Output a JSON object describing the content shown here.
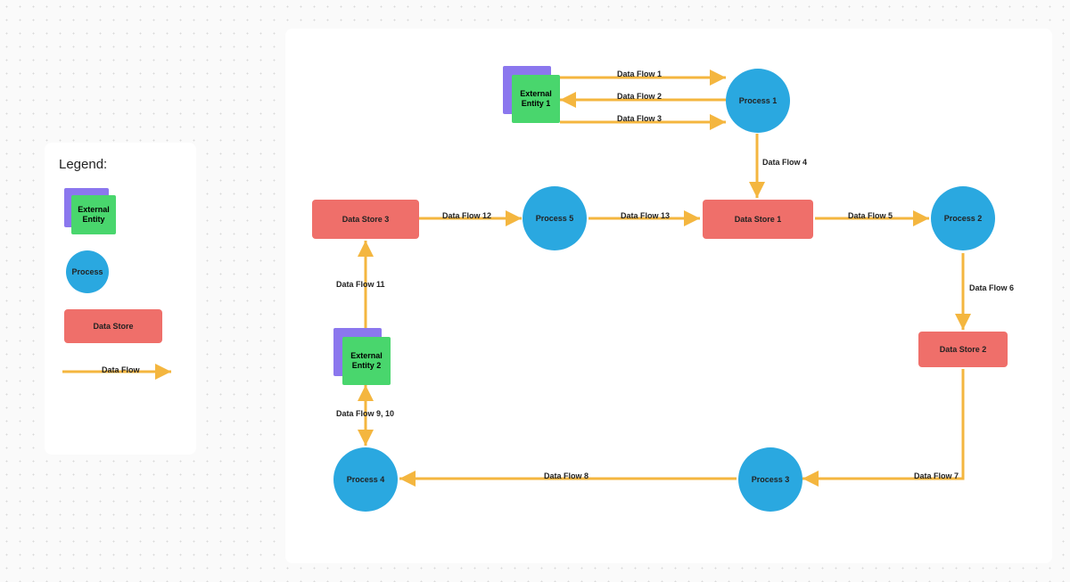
{
  "legend": {
    "title": "Legend:",
    "entity": "External\nEntity",
    "process": "Process",
    "datastore": "Data Store",
    "flow": "Data Flow"
  },
  "nodes": {
    "entity1": "External\nEntity 1",
    "entity2": "External\nEntity 2",
    "process1": "Process 1",
    "process2": "Process 2",
    "process3": "Process 3",
    "process4": "Process 4",
    "process5": "Process 5",
    "datastore1": "Data Store 1",
    "datastore2": "Data Store 2",
    "datastore3": "Data Store 3"
  },
  "flows": {
    "f1": "Data Flow 1",
    "f2": "Data Flow 2",
    "f3": "Data Flow 3",
    "f4": "Data Flow 4",
    "f5": "Data Flow 5",
    "f6": "Data Flow 6",
    "f7": "Data Flow 7",
    "f8": "Data Flow 8",
    "f910": "Data Flow 9, 10",
    "f11": "Data Flow 11",
    "f12": "Data Flow 12",
    "f13": "Data Flow 13"
  },
  "chart_data": {
    "type": "data-flow-diagram",
    "nodes": [
      {
        "id": "E1",
        "type": "external-entity",
        "label": "External Entity 1"
      },
      {
        "id": "E2",
        "type": "external-entity",
        "label": "External Entity 2"
      },
      {
        "id": "P1",
        "type": "process",
        "label": "Process 1"
      },
      {
        "id": "P2",
        "type": "process",
        "label": "Process 2"
      },
      {
        "id": "P3",
        "type": "process",
        "label": "Process 3"
      },
      {
        "id": "P4",
        "type": "process",
        "label": "Process 4"
      },
      {
        "id": "P5",
        "type": "process",
        "label": "Process 5"
      },
      {
        "id": "D1",
        "type": "data-store",
        "label": "Data Store 1"
      },
      {
        "id": "D2",
        "type": "data-store",
        "label": "Data Store 2"
      },
      {
        "id": "D3",
        "type": "data-store",
        "label": "Data Store 3"
      }
    ],
    "edges": [
      {
        "label": "Data Flow 1",
        "from": "E1",
        "to": "P1"
      },
      {
        "label": "Data Flow 2",
        "from": "P1",
        "to": "E1"
      },
      {
        "label": "Data Flow 3",
        "from": "E1",
        "to": "P1"
      },
      {
        "label": "Data Flow 4",
        "from": "P1",
        "to": "D1"
      },
      {
        "label": "Data Flow 5",
        "from": "D1",
        "to": "P2"
      },
      {
        "label": "Data Flow 6",
        "from": "P2",
        "to": "D2"
      },
      {
        "label": "Data Flow 7",
        "from": "D2",
        "to": "P3"
      },
      {
        "label": "Data Flow 8",
        "from": "P3",
        "to": "P4"
      },
      {
        "label": "Data Flow 9",
        "from": "P4",
        "to": "E2"
      },
      {
        "label": "Data Flow 10",
        "from": "E2",
        "to": "P4"
      },
      {
        "label": "Data Flow 11",
        "from": "E2",
        "to": "D3"
      },
      {
        "label": "Data Flow 12",
        "from": "D3",
        "to": "P5"
      },
      {
        "label": "Data Flow 13",
        "from": "P5",
        "to": "D1"
      }
    ],
    "legend": [
      "External Entity",
      "Process",
      "Data Store",
      "Data Flow"
    ]
  }
}
